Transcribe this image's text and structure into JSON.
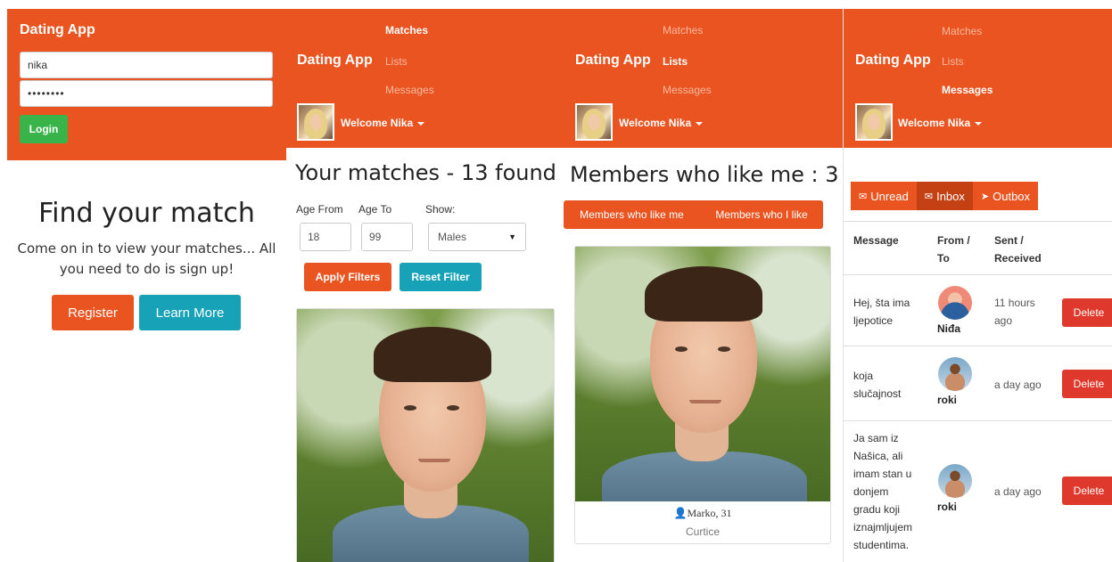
{
  "brand": "Dating App",
  "login": {
    "username_value": "nika",
    "password_value": "••••••••",
    "login_label": "Login"
  },
  "hero": {
    "title": "Find your match",
    "text": "Come on in to view your matches... All you need to do is sign up!",
    "register_label": "Register",
    "learn_more_label": "Learn More"
  },
  "nav": {
    "matches": "Matches",
    "lists": "Lists",
    "messages": "Messages",
    "welcome": "Welcome Nika"
  },
  "matches_page": {
    "title": "Your matches - 13 found",
    "age_from_label": "Age From",
    "age_to_label": "Age To",
    "show_label": "Show:",
    "age_from_value": "18",
    "age_to_value": "99",
    "show_value": "Males",
    "apply_label": "Apply Filters",
    "reset_label": "Reset Filter"
  },
  "lists_page": {
    "title": "Members who like me : 3",
    "tab_likers": "Members who like me",
    "tab_likees": "Members who I like",
    "card_name": "Marko, 31",
    "card_city": "Curtice"
  },
  "messages_page": {
    "tabs": [
      "Unread",
      "Inbox",
      "Outbox"
    ],
    "headers": {
      "message": "Message",
      "from_to_1": "From /",
      "from_to_2": "To",
      "sent_1": "Sent /",
      "sent_2": "Received"
    },
    "delete_label": "Delete",
    "rows": [
      {
        "lines": [
          "Hej, šta ima",
          "ljepotice"
        ],
        "sender": "Niđa",
        "time_lines": [
          "11 hours",
          "ago"
        ]
      },
      {
        "lines": [
          "koja",
          "slučajnost"
        ],
        "sender": "roki",
        "time_lines": [
          "a day ago"
        ]
      },
      {
        "lines": [
          "Ja sam iz",
          "Našica, ali",
          "imam stan u",
          "donjem",
          "gradu koji",
          "iznajmljujem",
          "studentima."
        ],
        "sender": "roki",
        "time_lines": [
          "a day ago"
        ]
      }
    ]
  },
  "colors": {
    "primary": "#e95420",
    "success": "#38b44a",
    "info": "#17a2b8",
    "danger": "#df382c"
  }
}
